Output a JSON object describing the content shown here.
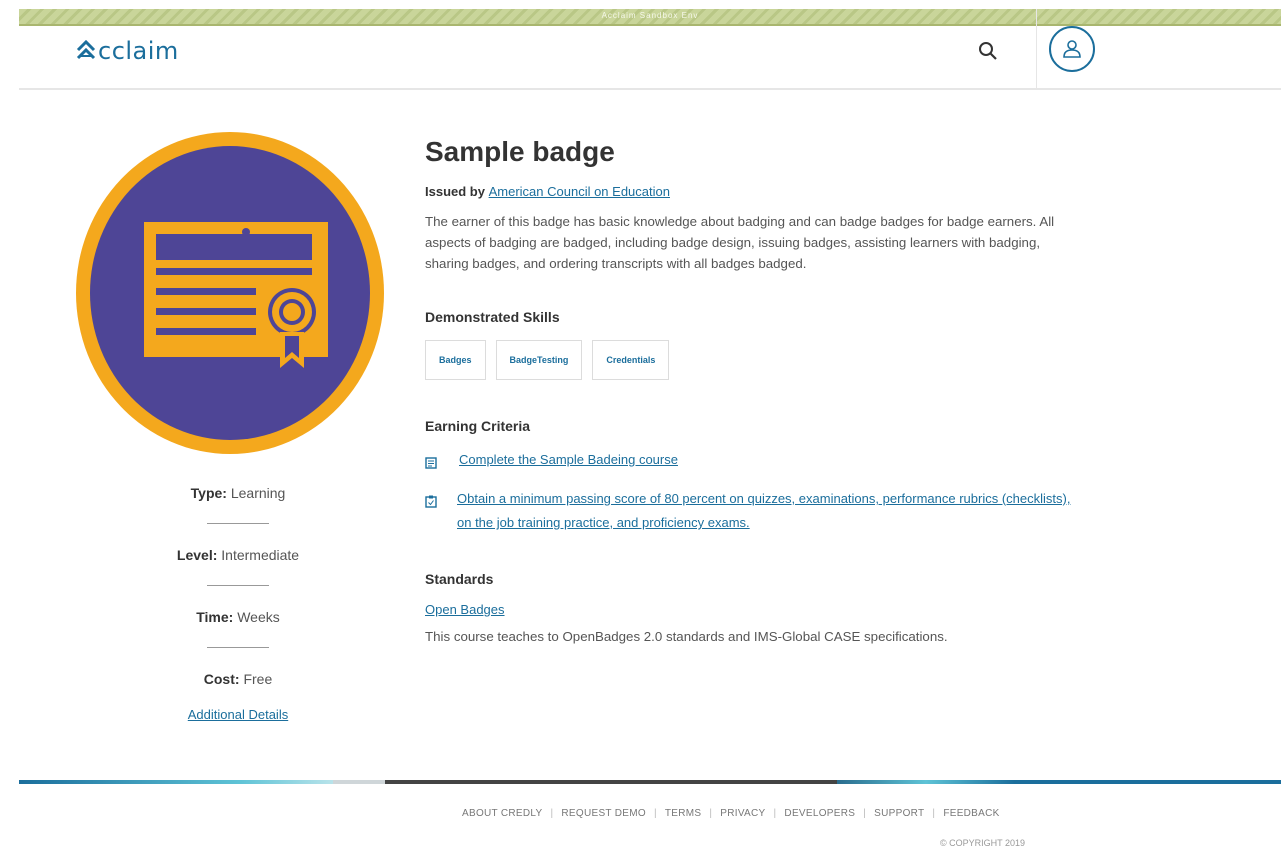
{
  "env_banner": "Acclaim Sandbox Env",
  "header": {
    "logo_text": "cclaim",
    "logo_mark": "A"
  },
  "badge": {
    "title": "Sample badge",
    "issued_by_label": "Issued by",
    "issuer": "American Council on Education",
    "description": "The earner of this badge has basic knowledge about badging and can badge badges for badge earners. All aspects of badging are badged, including badge design, issuing badges, assisting learners with badging, sharing badges, and ordering transcripts with all badges badged.",
    "colors": {
      "ring": "#f4a81d",
      "inner": "#4e4596",
      "art": "#f4a81d"
    }
  },
  "sidebar": {
    "type_label": "Type:",
    "type_value": "Learning",
    "level_label": "Level:",
    "level_value": "Intermediate",
    "time_label": "Time:",
    "time_value": "Weeks",
    "cost_label": "Cost:",
    "cost_value": "Free",
    "details_link": "Additional Details"
  },
  "skills": {
    "heading": "Demonstrated Skills",
    "items": [
      "Badges",
      "BadgeTesting",
      "Credentials"
    ]
  },
  "criteria": {
    "heading": "Earning Criteria",
    "items": [
      {
        "icon": "course-icon",
        "text": "Complete the Sample Badeing course"
      },
      {
        "icon": "assessment-icon",
        "text": "Obtain a  minimum passing score of 80 percent on quizzes, examinations, performance rubrics (checklists), on the job training practice, and proficiency exams."
      }
    ]
  },
  "standards": {
    "heading": "Standards",
    "link": "Open Badges",
    "text": "This course teaches to OpenBadges 2.0 standards and IMS-Global CASE specifications."
  },
  "footer": {
    "links": [
      "ABOUT CREDLY",
      "REQUEST DEMO",
      "TERMS",
      "PRIVACY",
      "DEVELOPERS",
      "SUPPORT",
      "FEEDBACK"
    ],
    "copyright": "© COPYRIGHT 2019"
  },
  "accent_color": "#1b6e9c"
}
